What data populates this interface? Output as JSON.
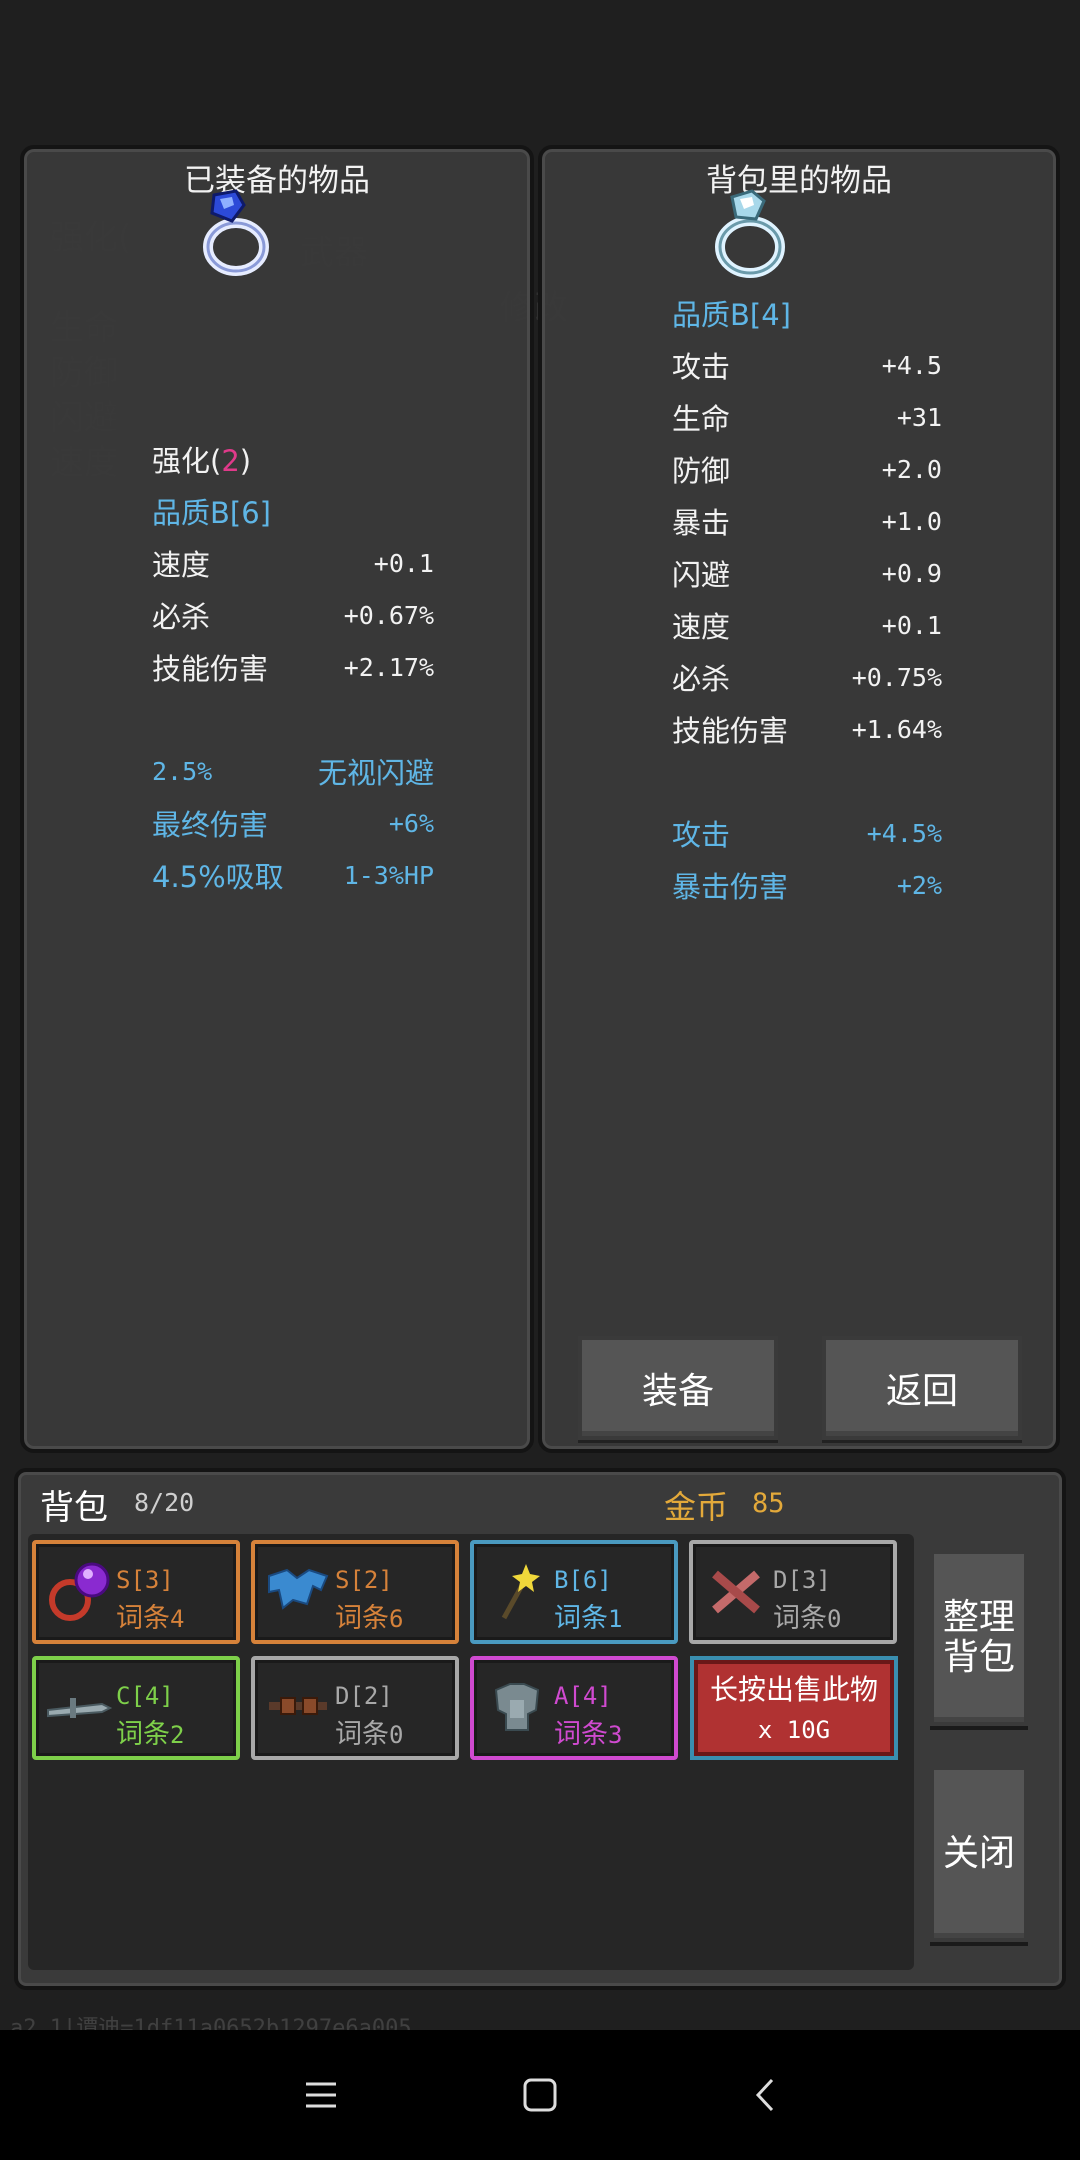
{
  "equipped_panel": {
    "title": "已装备的物品",
    "enhance_label": "强化(",
    "enhance_level": "2",
    "enhance_close": ")",
    "quality": "品质B[6]",
    "stats": [
      {
        "name": "速度",
        "value": "+0.1"
      },
      {
        "name": "必杀",
        "value": "+0.67%"
      },
      {
        "name": "技能伤害",
        "value": "+2.17%"
      }
    ],
    "bonus": [
      {
        "name": "2.5%",
        "value": "无视闪避"
      },
      {
        "name": "最终伤害",
        "value": "+6%"
      },
      {
        "name": "4.5%吸取",
        "value": "1-3%HP"
      }
    ]
  },
  "bag_item_panel": {
    "title": "背包里的物品",
    "quality": "品质B[4]",
    "stats": [
      {
        "name": "攻击",
        "value": "+4.5"
      },
      {
        "name": "生命",
        "value": "+31"
      },
      {
        "name": "防御",
        "value": "+2.0"
      },
      {
        "name": "暴击",
        "value": "+1.0"
      },
      {
        "name": "闪避",
        "value": "+0.9"
      },
      {
        "name": "速度",
        "value": "+0.1"
      },
      {
        "name": "必杀",
        "value": "+0.75%"
      },
      {
        "name": "技能伤害",
        "value": "+1.64%"
      }
    ],
    "bonus": [
      {
        "name": "攻击",
        "value": "+4.5%"
      },
      {
        "name": "暴击伤害",
        "value": "+2%"
      }
    ],
    "equip_button": "装备",
    "back_button": "返回"
  },
  "inventory": {
    "title": "背包",
    "count": "8/20",
    "gold_label": "金币",
    "gold_value": "85",
    "slots": [
      {
        "grade": "S[3]",
        "entry_label": "词条",
        "entry_count": "4",
        "color": "#d6823a",
        "icon": "orb-ring-icon"
      },
      {
        "grade": "S[2]",
        "entry_label": "词条",
        "entry_count": "6",
        "color": "#d6823a",
        "icon": "blue-cape-icon"
      },
      {
        "grade": "B[6]",
        "entry_label": "词条",
        "entry_count": "1",
        "color": "#5fb6e6",
        "icon": "magic-wand-icon"
      },
      {
        "grade": "D[3]",
        "entry_label": "词条",
        "entry_count": "0",
        "color": "#a8a8a8",
        "icon": "bone-icon"
      },
      {
        "grade": "C[4]",
        "entry_label": "词条",
        "entry_count": "2",
        "color": "#7ed04a",
        "icon": "gray-sword-icon"
      },
      {
        "grade": "D[2]",
        "entry_label": "词条",
        "entry_count": "0",
        "color": "#a8a8a8",
        "icon": "goggles-icon"
      },
      {
        "grade": "A[4]",
        "entry_label": "词条",
        "entry_count": "3",
        "color": "#d04ad0",
        "icon": "armor-icon"
      }
    ],
    "sell_line1": "长按出售此物",
    "sell_line2": "x 10G",
    "sort_button": "整理背包",
    "close_button": "关闭"
  },
  "debug_text": "a2.1|谭迪=1df11a0652b1297e6a005"
}
